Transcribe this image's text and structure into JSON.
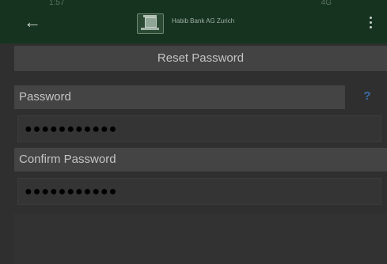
{
  "status_bar": {
    "time": "1:57",
    "signal": "4G"
  },
  "app_bar": {
    "back_icon": "arrow-left-icon",
    "logo_icon": "bank-logo-icon",
    "bank_name": "Habib Bank AG Zurich",
    "menu_icon": "more-vertical-icon"
  },
  "page": {
    "title": "Reset Password"
  },
  "form": {
    "password_label": "Password",
    "help_symbol": "?",
    "password_value": "●●●●●●●●●●●",
    "confirm_label": "Confirm Password",
    "confirm_value": "●●●●●●●●●●●"
  },
  "colors": {
    "app_bar_bg": "#16331f",
    "help_icon": "#3b6ea8",
    "label_bar_bg": "#444444"
  }
}
